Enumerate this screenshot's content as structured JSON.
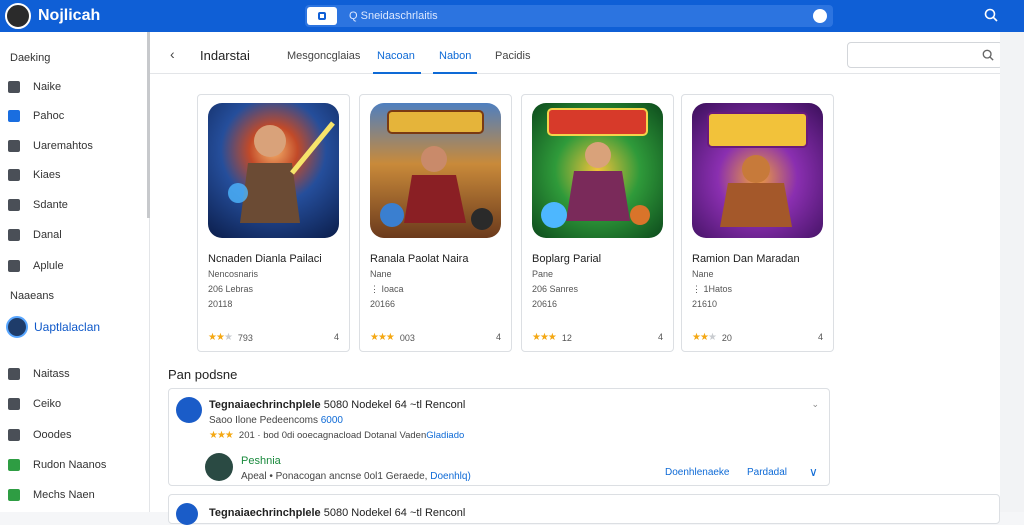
{
  "topbar": {
    "app_title": "Nojlicah",
    "search_text": "Q Sneidaschrlaitis"
  },
  "sidebar": {
    "heading": "Daeking",
    "items": [
      {
        "label": "Naike",
        "icon": "bag-icon"
      },
      {
        "label": "Pahoc",
        "icon": "blue-square-icon"
      },
      {
        "label": "Uaremahtos",
        "icon": "list-icon"
      },
      {
        "label": "Kiaes",
        "icon": "star-icon"
      },
      {
        "label": "Sdante",
        "icon": "tag-icon"
      },
      {
        "label": "Danal",
        "icon": "square-icon"
      },
      {
        "label": "Aplule",
        "icon": "upload-icon"
      }
    ],
    "section_label": "Naaeans",
    "user_name": "Uaptlalaclan",
    "items2": [
      {
        "label": "Naitass",
        "icon": "people-icon"
      },
      {
        "label": "Ceiko",
        "icon": "card-icon"
      },
      {
        "label": "Ooodes",
        "icon": "docs-icon"
      },
      {
        "label": "Rudon Naanos",
        "icon": "green-doc-icon"
      },
      {
        "label": "Mechs Naen",
        "icon": "green-book-icon"
      }
    ]
  },
  "tabbar": {
    "page_title": "Indarstai",
    "tabs": [
      {
        "label": "Mesgoncglaias",
        "active": false
      },
      {
        "label": "Nacoan",
        "active": true
      },
      {
        "label": "Nabon",
        "active": true
      },
      {
        "label": "Pacidis",
        "active": false
      }
    ]
  },
  "cards": [
    {
      "name": "Ncnaden Dianla Pailaci",
      "meta1": "Nencosnaris",
      "meta2": "206 Lebras",
      "meta3": "20118",
      "rating_text": "793",
      "count": "4",
      "stars_on": 2.5
    },
    {
      "name": "Ranala Paolat Naira",
      "meta1": "Nane",
      "meta2": "⋮ Ioaca",
      "meta3": "20166",
      "rating_text": "003",
      "count": "4",
      "stars_on": 3
    },
    {
      "name": "Boplarg Parial",
      "meta1": "Pane",
      "meta2": "206 Sanres",
      "meta3": "20616",
      "rating_text": "12",
      "count": "4",
      "stars_on": 3
    },
    {
      "name": "Ramion Dan Maradan",
      "meta1": "Nane",
      "meta2": "⋮ 1Hatos",
      "meta3": "21610",
      "rating_text": "20",
      "count": "4",
      "stars_on": 2
    }
  ],
  "section": {
    "title": "Pan podsne"
  },
  "list_item": {
    "title_bold": "Tegnaiaechrinchplele",
    "title_rest": "5080 Nodekel 64 ~tl Renconl",
    "sub_prefix": "Saoo Ilone Pedeencoms",
    "sub_blue": "6000",
    "rating_text": "201 · bod 0di ooecagnacload Dotanal Vaden",
    "rating_blue": "Gladiado",
    "reviewer_name": "Peshnia",
    "review_prefix": "Apeal •",
    "review_text": "Ponacogan ancnse 0ol1 Geraede,",
    "review_blue": "Doenhlq)",
    "action_1": "Doenhlenaeke",
    "action_2": "Pardadal"
  },
  "list_item2": {
    "title_bold": "Tegnaiaechrinchplele",
    "title_rest": "5080 Nodekel 64 ~tl Renconl"
  }
}
